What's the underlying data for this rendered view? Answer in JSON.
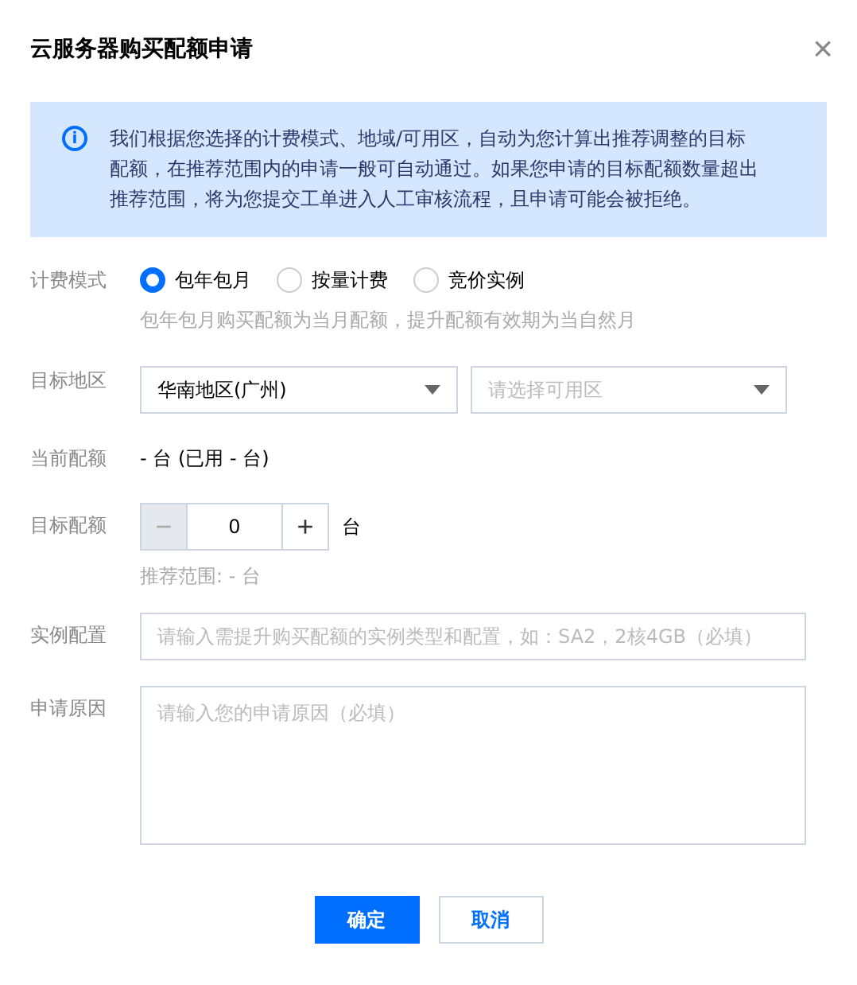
{
  "dialog": {
    "title": "云服务器购买配额申请",
    "close": "×"
  },
  "alert": {
    "icon": "i",
    "text": "我们根据您选择的计费模式、地域/可用区，自动为您计算出推荐调整的目标配额，在推荐范围内的申请一般可自动通过。如果您申请的目标配额数量超出推荐范围，将为您提交工单进入人工审核流程，且申请可能会被拒绝。"
  },
  "billing": {
    "label": "计费模式",
    "options": [
      {
        "label": "包年包月",
        "selected": true
      },
      {
        "label": "按量计费",
        "selected": false
      },
      {
        "label": "竞价实例",
        "selected": false
      }
    ],
    "hint": "包年包月购买配额为当月配额，提升配额有效期为当自然月"
  },
  "region": {
    "label": "目标地区",
    "selects": [
      {
        "value": "华南地区(广州)"
      },
      {
        "placeholder": "请选择可用区"
      }
    ]
  },
  "current": {
    "label": "当前配额",
    "value": "- 台 (已用 - 台)"
  },
  "target": {
    "label": "目标配额",
    "minus": {
      "symbol": "−",
      "disabled": true
    },
    "value": "0",
    "plus": {
      "symbol": "+",
      "disabled": false
    },
    "unit": "台",
    "hint": "推荐范围: - 台"
  },
  "instance": {
    "label": "实例配置",
    "placeholder": "请输入需提升购买配额的实例类型和配置，如：SA2，2核4GB（必填）"
  },
  "reason": {
    "label": "申请原因",
    "placeholder": "请输入您的申请原因（必填）"
  },
  "buttons": [
    {
      "label": "确定",
      "kind": "primary"
    },
    {
      "label": "取消",
      "kind": "secondary"
    }
  ]
}
